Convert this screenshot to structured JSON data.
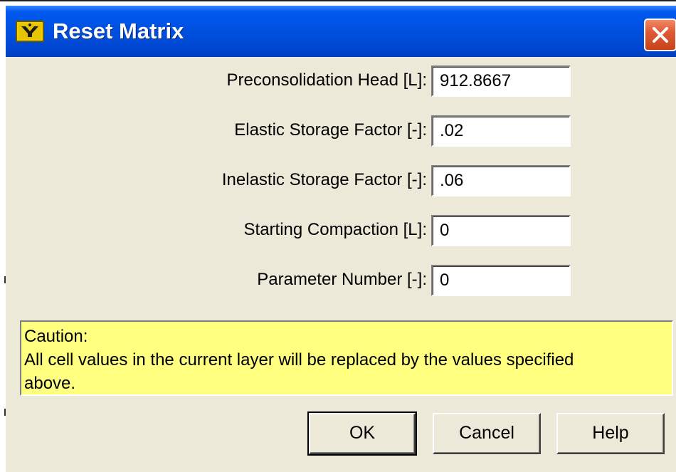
{
  "window": {
    "title": "Reset Matrix"
  },
  "fields": [
    {
      "label": "Preconsolidation Head [L]:",
      "value": "912.8667"
    },
    {
      "label": "Elastic Storage Factor [-]:",
      "value": ".02"
    },
    {
      "label": "Inelastic Storage Factor [-]:",
      "value": ".06"
    },
    {
      "label": "Starting Compaction [L]:",
      "value": "0"
    },
    {
      "label": "Parameter Number [-]:",
      "value": "0"
    }
  ],
  "caution": {
    "line1": "Caution:",
    "line2": "All cell values in the current layer will be replaced by the values specified",
    "line3": "above."
  },
  "buttons": {
    "ok": "OK",
    "cancel": "Cancel",
    "help": "Help"
  },
  "colors": {
    "titlebar": "#0050e0",
    "caution_bg": "#ffff80",
    "dialog_bg": "#ece9d8",
    "close_btn": "#e05a33"
  },
  "icons": {
    "title_icon": "app-icon",
    "close": "close-icon"
  }
}
